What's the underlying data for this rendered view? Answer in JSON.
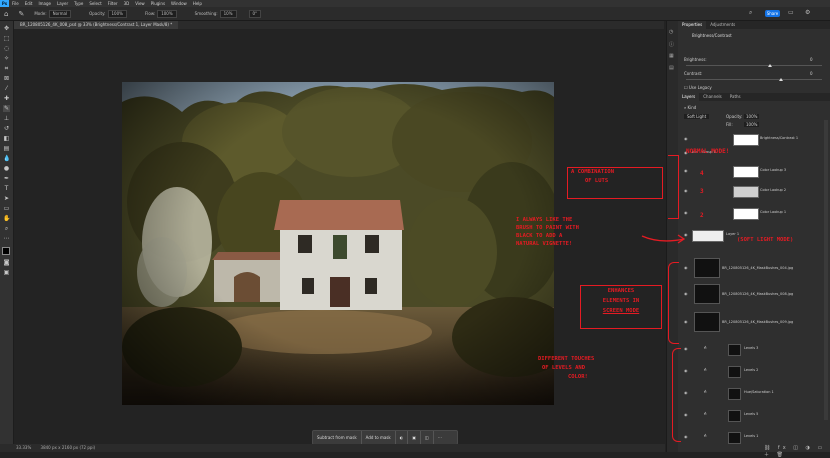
{
  "menu": {
    "app_logo": "Ps",
    "items": [
      "File",
      "Edit",
      "Image",
      "Layer",
      "Type",
      "Select",
      "Filter",
      "3D",
      "View",
      "Plugins",
      "Window",
      "Help"
    ]
  },
  "options": {
    "mode_label": "Mode:",
    "mode_value": "Normal",
    "opacity_label": "Opacity:",
    "opacity_value": "100%",
    "flow_label": "Flow:",
    "flow_value": "100%",
    "smoothing_label": "Smoothing:",
    "smoothing_value": "10%",
    "angle_value": "0°",
    "share_label": "Share"
  },
  "document": {
    "tab_title": "BR_120805126_4K_008_psd @ 33% (Brightness/Contrast 1, Layer Mask/8) *"
  },
  "status": {
    "zoom": "33.33%",
    "doc_size": "3840 px x 2160 px (72 ppi)"
  },
  "context_bar": {
    "subtract_label": "Subtract from mask",
    "add_label": "Add to mask"
  },
  "properties": {
    "tabs": [
      "Properties",
      "Adjustments"
    ],
    "adjustment_title": "Brightness/Contrast",
    "brightness_label": "Brightness:",
    "brightness_value": "0",
    "contrast_label": "Contrast:",
    "contrast_value": "0",
    "use_legacy_label": "Use Legacy",
    "brightness_level": 0.62,
    "contrast_level": 0.7
  },
  "layers_panel": {
    "tabs": [
      "Layers",
      "Channels",
      "Paths"
    ],
    "blend_mode": "Soft Light",
    "opacity_label": "Opacity:",
    "opacity_value": "100%",
    "fill_label": "Fill:",
    "fill_value": "100%",
    "layers": [
      {
        "name": "Brightness/Contrast 1",
        "kind": "mask-white"
      },
      {
        "name": "Group 1",
        "kind": "group"
      },
      {
        "name": "Color Lookup 3",
        "kind": "mask-white"
      },
      {
        "name": "Color Lookup 2",
        "kind": "mask-speckle"
      },
      {
        "name": "Color Lookup 1",
        "kind": "mask-white"
      },
      {
        "name": "Layer 1",
        "kind": "mask-vignette"
      },
      {
        "name": "BR_120805126_4K_MaskBushes_004.jpg",
        "kind": "dark"
      },
      {
        "name": "BR_120805126_4K_MaskBushes_008.jpg",
        "kind": "dark"
      },
      {
        "name": "BR_120805126_4K_MaskBushes_009.jpg",
        "kind": "dark"
      },
      {
        "name": "Levels 3",
        "kind": "levels"
      },
      {
        "name": "Levels 2",
        "kind": "levels"
      },
      {
        "name": "Hue/Saturation 1",
        "kind": "levels"
      },
      {
        "name": "Levels 5",
        "kind": "levels"
      },
      {
        "name": "Levels 1",
        "kind": "levels"
      }
    ]
  },
  "annotations": {
    "combination_l1": "A COMBINATION",
    "combination_l2": "OF LUTS",
    "numbers": [
      "4",
      "3",
      "2"
    ],
    "normal_mode": "NORMAL MODE!",
    "brush_l1": "I ALWAYS LIKE THE",
    "brush_l2": "BRUSH TO PAINT WITH",
    "brush_l3": "BLACK TO ADD A",
    "brush_l4": "NATURAL VIGNETTE!",
    "soft_light": "(SOFT LIGHT MODE)",
    "enhances_l1": "ENHANCES",
    "enhances_l2": "ELEMENTS IN",
    "enhances_l3": "SCREEN MODE",
    "levels_l1": "DIFFERENT TOUCHES",
    "levels_l2": "OF LEVELS AND",
    "levels_l3": "COLOR!"
  },
  "colors": {
    "annotation_red": "#e51b23",
    "accent_blue": "#1473e6"
  }
}
